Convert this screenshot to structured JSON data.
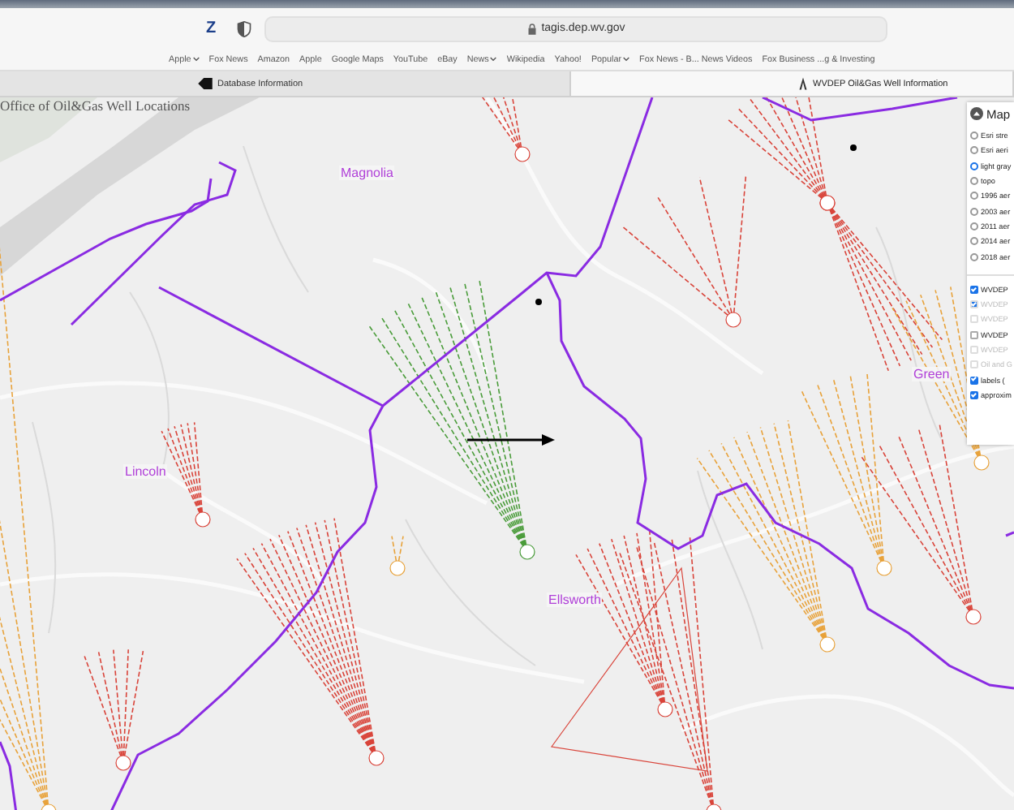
{
  "browser": {
    "profile_letter": "Z",
    "url": "tagis.dep.wv.gov"
  },
  "bookmarks": [
    {
      "label": "Apple",
      "menu": true
    },
    {
      "label": "Fox News",
      "menu": false
    },
    {
      "label": "Amazon",
      "menu": false
    },
    {
      "label": "Apple",
      "menu": false
    },
    {
      "label": "Google Maps",
      "menu": false
    },
    {
      "label": "YouTube",
      "menu": false
    },
    {
      "label": "eBay",
      "menu": false
    },
    {
      "label": "News",
      "menu": true
    },
    {
      "label": "Wikipedia",
      "menu": false
    },
    {
      "label": "Yahoo!",
      "menu": false
    },
    {
      "label": "Popular",
      "menu": true
    },
    {
      "label": "Fox News - B... News Videos",
      "menu": false
    },
    {
      "label": "Fox Business ...g & Investing",
      "menu": false
    }
  ],
  "tabs": [
    {
      "label": "Database Information",
      "selected": false
    },
    {
      "label": "WVDEP Oil&Gas Well Information",
      "selected": true
    }
  ],
  "map": {
    "title": "Office of Oil&Gas Well Locations",
    "districts": [
      {
        "label": "Magnolia"
      },
      {
        "label": "Lincoln"
      },
      {
        "label": "Green"
      },
      {
        "label": "Ellsworth"
      }
    ]
  },
  "layers_panel": {
    "title": "Map",
    "basemaps": [
      {
        "label": "Esri stre",
        "selected": false
      },
      {
        "label": "Esri aeri",
        "selected": false
      },
      {
        "label": "light gray",
        "selected": true
      },
      {
        "label": "topo",
        "selected": false
      },
      {
        "label": "1996 aer",
        "selected": false
      },
      {
        "label": "2003 aer",
        "selected": false
      },
      {
        "label": "2011 aer",
        "selected": false
      },
      {
        "label": "2014 aer",
        "selected": false
      },
      {
        "label": "2018 aer",
        "selected": false
      }
    ],
    "overlays": [
      {
        "label": "WVDEP",
        "checked": true,
        "disabled": false
      },
      {
        "label": "WVDEP",
        "checked": true,
        "disabled": true
      },
      {
        "label": "WVDEP",
        "checked": false,
        "disabled": true
      },
      {
        "label": "WVDEP",
        "checked": false,
        "disabled": false
      },
      {
        "label": "WVDEP",
        "checked": false,
        "disabled": true
      },
      {
        "label": "Oil and G",
        "checked": false,
        "disabled": true
      },
      {
        "label": "labels (",
        "checked": true,
        "disabled": false
      },
      {
        "label": "approxim",
        "checked": true,
        "disabled": false
      }
    ]
  }
}
